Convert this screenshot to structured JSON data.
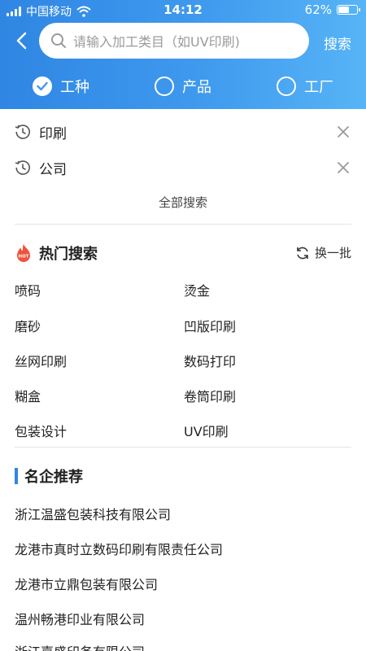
{
  "status_bar": {
    "carrier": "中国移动",
    "time": "14:12",
    "battery": "62%",
    "battery_level": 0.62
  },
  "search": {
    "placeholder": "请输入加工类目（如UV印刷)",
    "button_label": "搜索"
  },
  "tabs": [
    {
      "label": "工种",
      "selected": true
    },
    {
      "label": "产品",
      "selected": false
    },
    {
      "label": "工厂",
      "selected": false
    }
  ],
  "history": {
    "items": [
      "印刷",
      "公司"
    ],
    "all_label": "全部搜索"
  },
  "hot_search": {
    "title": "热门搜索",
    "badge": "HOT",
    "refresh_label": "换一批",
    "items": [
      "喷码",
      "烫金",
      "磨砂",
      "凹版印刷",
      "丝网印刷",
      "数码打印",
      "糊盒",
      "卷筒印刷",
      "包装设计",
      "UV印刷"
    ]
  },
  "brands": {
    "title": "名企推荐",
    "items": [
      "浙江温盛包装科技有限公司",
      "龙港市真时立数码印刷有限责任公司",
      "龙港市立鼎包装有限公司",
      "温州畅港印业有限公司",
      "浙江嘉盛印务有限公司"
    ]
  },
  "colors": {
    "accent": "#2f86e3",
    "header_end": "#57b4f6",
    "hot_icon": "#f0533a"
  },
  "icons": [
    "back-icon",
    "search-icon",
    "check-icon",
    "history-icon",
    "close-icon",
    "hot-flame-icon",
    "refresh-icon",
    "wifi-icon",
    "signal-icon",
    "battery-icon"
  ]
}
